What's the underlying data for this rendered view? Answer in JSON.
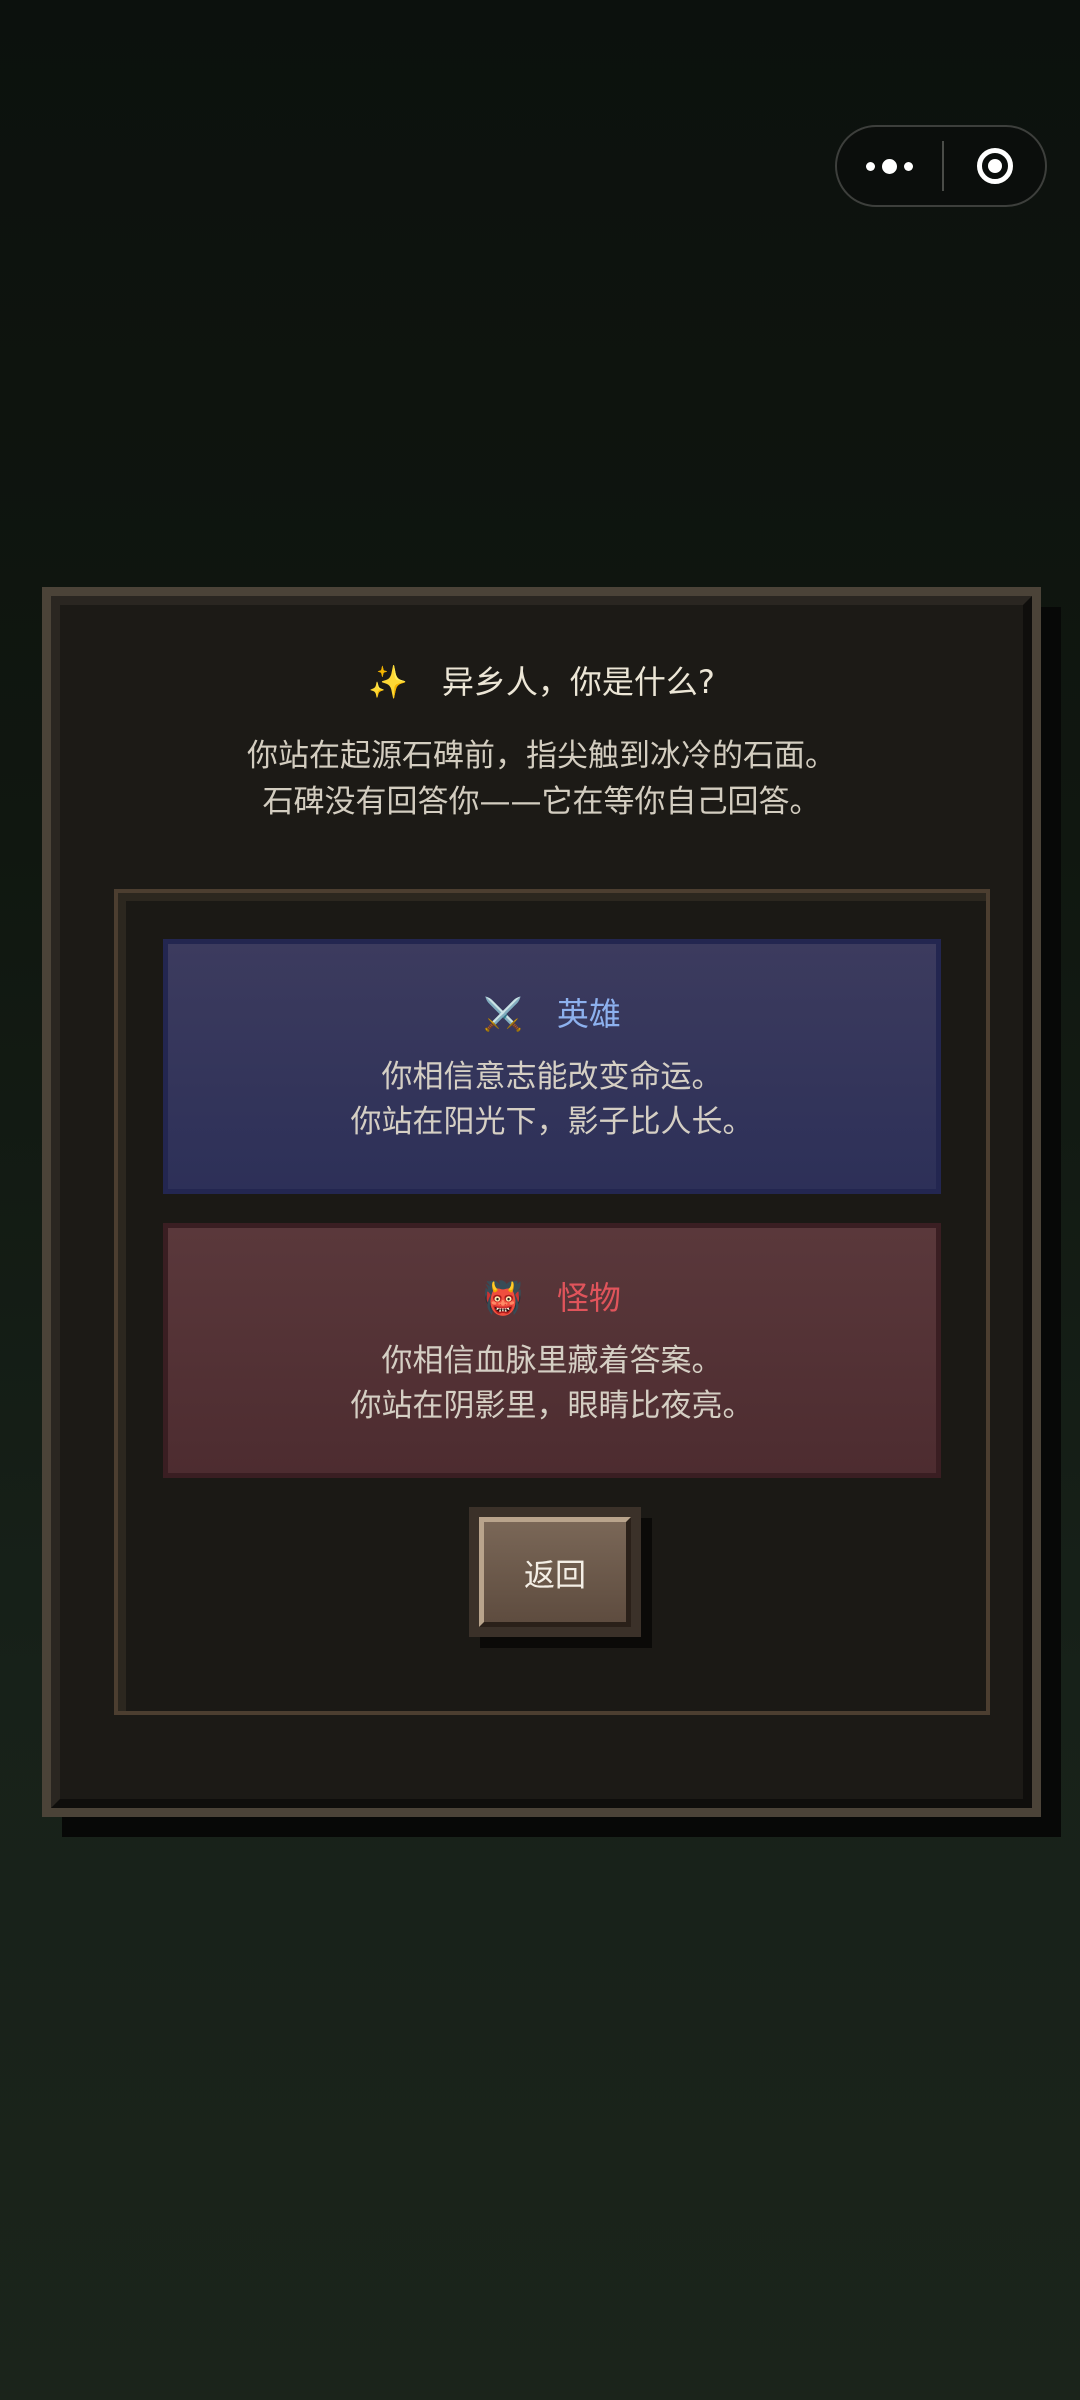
{
  "capsule": {
    "more_icon": "more-dots-icon",
    "close_icon": "target-circle-icon"
  },
  "dialog": {
    "title_icon": "✨",
    "title": "异乡人，你是什么?",
    "intro_line_1": "你站在起源石碑前，指尖触到冰冷的石面。",
    "intro_line_2": "石碑没有回答你——它在等你自己回答。"
  },
  "choices": [
    {
      "icon": "⚔️",
      "name": "英雄",
      "line_1": "你相信意志能改变命运。",
      "line_2": "你站在阳光下，影子比人长。",
      "color": "#2d3058"
    },
    {
      "icon": "👹",
      "name": "怪物",
      "line_1": "你相信血脉里藏着答案。",
      "line_2": "你站在阴影里，眼睛比夜亮。",
      "color": "#4d2c30"
    }
  ],
  "back_button": {
    "label": "返回"
  }
}
